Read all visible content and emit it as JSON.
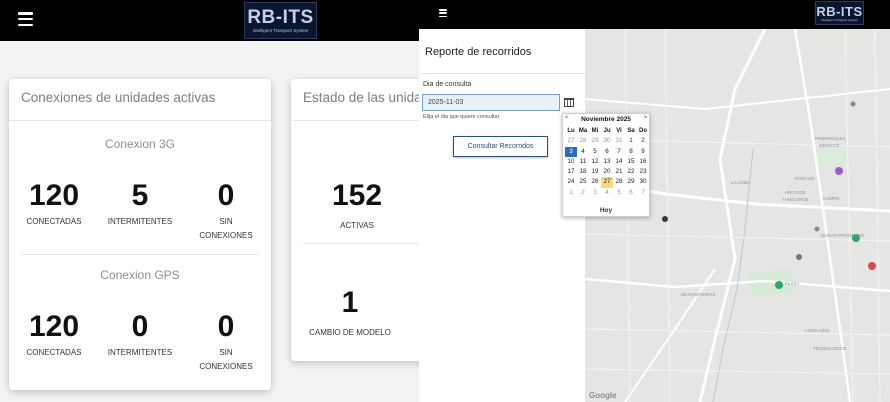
{
  "left": {
    "header": {
      "logo_main": "RB-ITS",
      "logo_sub": "Intelligent Transport System"
    },
    "card_active": {
      "title": "Conexiones de unidades activas",
      "sections": [
        {
          "title": "Conexion 3G",
          "metrics": [
            {
              "value": "120",
              "label": "CONECTADAS"
            },
            {
              "value": "5",
              "label": "INTERMITENTES"
            },
            {
              "value": "0",
              "label": "SIN",
              "label2": "CONEXIONES"
            }
          ]
        },
        {
          "title": "Conexion GPS",
          "metrics": [
            {
              "value": "120",
              "label": "CONECTADAS"
            },
            {
              "value": "0",
              "label": "INTERMITENTES"
            },
            {
              "value": "0",
              "label": "SIN",
              "label2": "CONEXIONES"
            }
          ]
        }
      ]
    },
    "card_status": {
      "title": "Estado de las unidades",
      "metrics": [
        {
          "value": "152",
          "label": "ACTIVAS"
        },
        {
          "value": "1",
          "label": "CAMBIO DE MODELO"
        }
      ]
    }
  },
  "right": {
    "header": {
      "logo_main": "RB-ITS",
      "logo_sub": "Intelligent Transport System"
    },
    "panel": {
      "title": "Reporte de recorridos",
      "field_label": "Dia de consulta",
      "date_value": "2025-11-03",
      "hint": "Elija el dia que quiere consultar",
      "consult_button": "Consultar Recorridos"
    },
    "calendar": {
      "prev": "<",
      "month_label": "Noviembre 2025",
      "next": ">",
      "weekdays": [
        "Lu",
        "Ma",
        "Mi",
        "Ju",
        "Vi",
        "Sa",
        "Do"
      ],
      "weeks": [
        [
          "27",
          "28",
          "29",
          "30",
          "31",
          "1",
          "2"
        ],
        [
          "3",
          "4",
          "5",
          "6",
          "7",
          "8",
          "9"
        ],
        [
          "10",
          "11",
          "12",
          "13",
          "14",
          "15",
          "16"
        ],
        [
          "17",
          "18",
          "19",
          "20",
          "21",
          "22",
          "23"
        ],
        [
          "24",
          "25",
          "26",
          "27",
          "28",
          "29",
          "30"
        ],
        [
          "1",
          "2",
          "3",
          "4",
          "5",
          "6",
          "7"
        ]
      ],
      "today_button": "Hoy"
    },
    "map": {
      "labels": [
        "Pedregales",
        "Monaco",
        "Rancho",
        "La Loma",
        "Arco de",
        "Hancorde",
        "Campo",
        "Nuevo Progreso",
        "Plaza",
        "Loma Azul",
        "Maganiteiros",
        "Tecnologico"
      ],
      "attribution": "Google"
    }
  }
}
